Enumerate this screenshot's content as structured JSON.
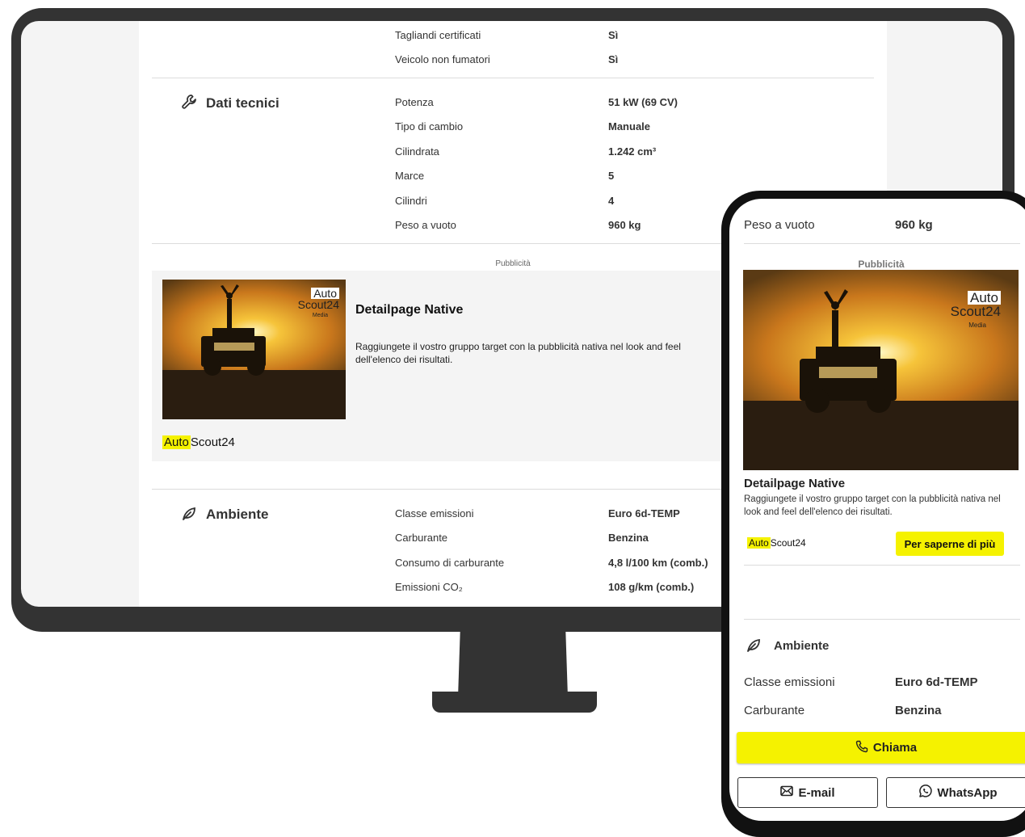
{
  "desktop": {
    "rows_top": [
      {
        "label": "Tagliandi certificati",
        "value": "Sì"
      },
      {
        "label": "Veicolo non fumatori",
        "value": "Sì"
      }
    ],
    "tech_section": {
      "title": "Dati tecnici",
      "rows": [
        {
          "label": "Potenza",
          "value": "51 kW (69 CV)"
        },
        {
          "label": "Tipo di cambio",
          "value": "Manuale"
        },
        {
          "label": "Cilindrata",
          "value": "1.242 cm³"
        },
        {
          "label": "Marce",
          "value": "5"
        },
        {
          "label": "Cilindri",
          "value": "4"
        },
        {
          "label": "Peso a vuoto",
          "value": "960 kg"
        }
      ]
    },
    "ad": {
      "label": "Pubblicità",
      "title": "Detailpage Native",
      "text": "Raggiungete il vostro gruppo target con la pubblicità nativa nel look and feel dell'elenco dei risultati.",
      "image_logo_top": "Auto",
      "image_logo_bottom": "Scout24",
      "image_logo_sub": "Media",
      "brand_part1": "Auto",
      "brand_part2": "Scout24"
    },
    "env_section": {
      "title": "Ambiente",
      "rows": [
        {
          "label": "Classe emissioni",
          "value": "Euro 6d-TEMP"
        },
        {
          "label": "Carburante",
          "value": "Benzina"
        },
        {
          "label": "Consumo di carburante",
          "value": "4,8 l/100 km (comb.)"
        },
        {
          "label": "Emissioni CO₂",
          "value": "108 g/km (comb.)"
        }
      ]
    }
  },
  "mobile": {
    "top_row": {
      "label": "Peso a vuoto",
      "value": "960 kg"
    },
    "ad": {
      "label": "Pubblicità",
      "title": "Detailpage Native",
      "text": "Raggiungete il vostro gruppo target con la pubblicità nativa nel look and feel dell'elenco dei risultati.",
      "image_logo_top": "Auto",
      "image_logo_bottom": "Scout24",
      "image_logo_sub": "Media",
      "brand_part1": "Auto",
      "brand_part2": "Scout24",
      "cta": "Per saperne di più"
    },
    "env_section": {
      "title": "Ambiente",
      "rows": [
        {
          "label": "Classe emissioni",
          "value": "Euro 6d-TEMP"
        },
        {
          "label": "Carburante",
          "value": "Benzina"
        }
      ]
    },
    "actions": {
      "call": "Chiama",
      "email": "E-mail",
      "whatsapp": "WhatsApp"
    }
  },
  "colors": {
    "accent_yellow": "#f5f200",
    "frame_dark": "#333333",
    "divider": "#dcdcdc"
  }
}
